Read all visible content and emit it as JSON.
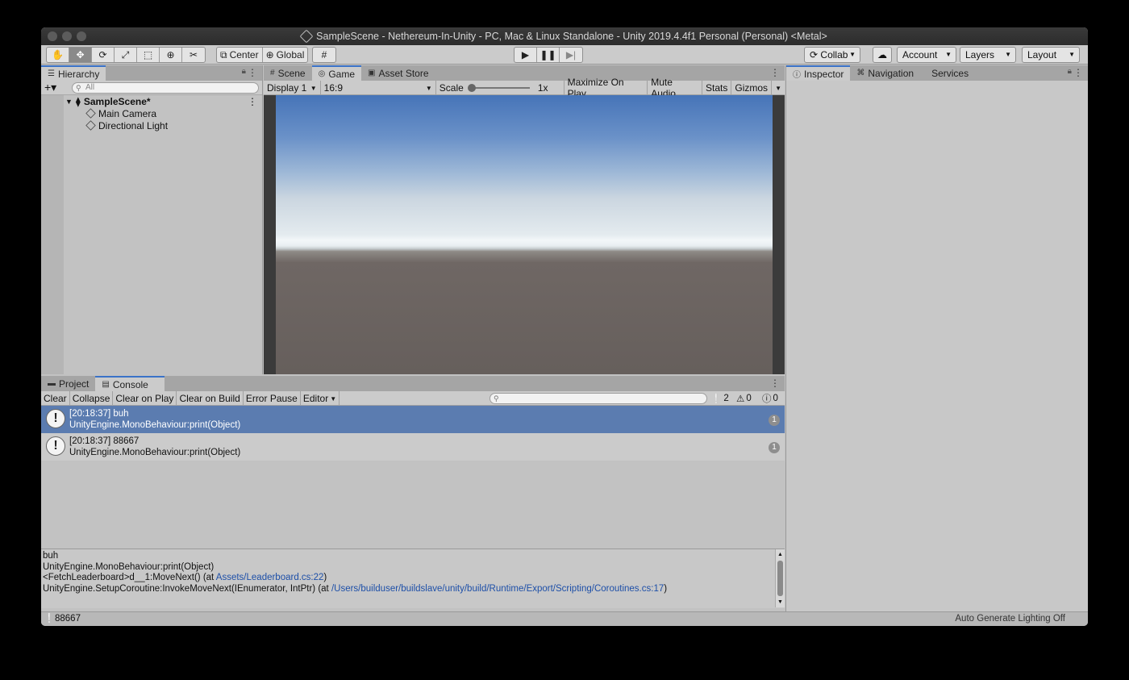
{
  "window": {
    "title": "SampleScene - Nethereum-In-Unity - PC, Mac & Linux Standalone - Unity 2019.4.4f1 Personal (Personal) <Metal>"
  },
  "toolbar": {
    "pivot_mode": "Center",
    "pivot_rotation": "Global",
    "collab": "Collab",
    "account": "Account",
    "layers": "Layers",
    "layout": "Layout"
  },
  "hierarchy": {
    "tab": "Hierarchy",
    "search_placeholder": "All",
    "scene": "SampleScene*",
    "items": [
      "Main Camera",
      "Directional Light"
    ]
  },
  "center": {
    "tabs": [
      "Scene",
      "Game",
      "Asset Store"
    ],
    "display": "Display 1",
    "aspect": "16:9",
    "scale_label": "Scale",
    "scale_value": "1x",
    "maximize": "Maximize On Play",
    "mute": "Mute Audio",
    "stats": "Stats",
    "gizmos": "Gizmos"
  },
  "inspector": {
    "tabs": [
      "Inspector",
      "Navigation",
      "Services"
    ]
  },
  "bottom": {
    "tabs": [
      "Project",
      "Console"
    ],
    "buttons": [
      "Clear",
      "Collapse",
      "Clear on Play",
      "Clear on Build",
      "Error Pause",
      "Editor"
    ],
    "counts": {
      "warnings_log": "2",
      "warnings": "0",
      "errors": "0"
    },
    "logs": [
      {
        "line1": "[20:18:37] buh",
        "line2": "UnityEngine.MonoBehaviour:print(Object)",
        "count": "1"
      },
      {
        "line1": "[20:18:37] 88667",
        "line2": "UnityEngine.MonoBehaviour:print(Object)",
        "count": "1"
      }
    ],
    "detail": {
      "l1": "buh",
      "l2": "UnityEngine.MonoBehaviour:print(Object)",
      "l3_pre": "<FetchLeaderboard>d__1:MoveNext() (at ",
      "l3_link": "Assets/Leaderboard.cs:22",
      "l3_post": ")",
      "l4_pre": "UnityEngine.SetupCoroutine:InvokeMoveNext(IEnumerator, IntPtr) (at ",
      "l4_link": "/Users/builduser/buildslave/unity/build/Runtime/Export/Scripting/Coroutines.cs:17",
      "l4_post": ")"
    }
  },
  "status": {
    "message": "88667",
    "lighting": "Auto Generate Lighting Off"
  }
}
